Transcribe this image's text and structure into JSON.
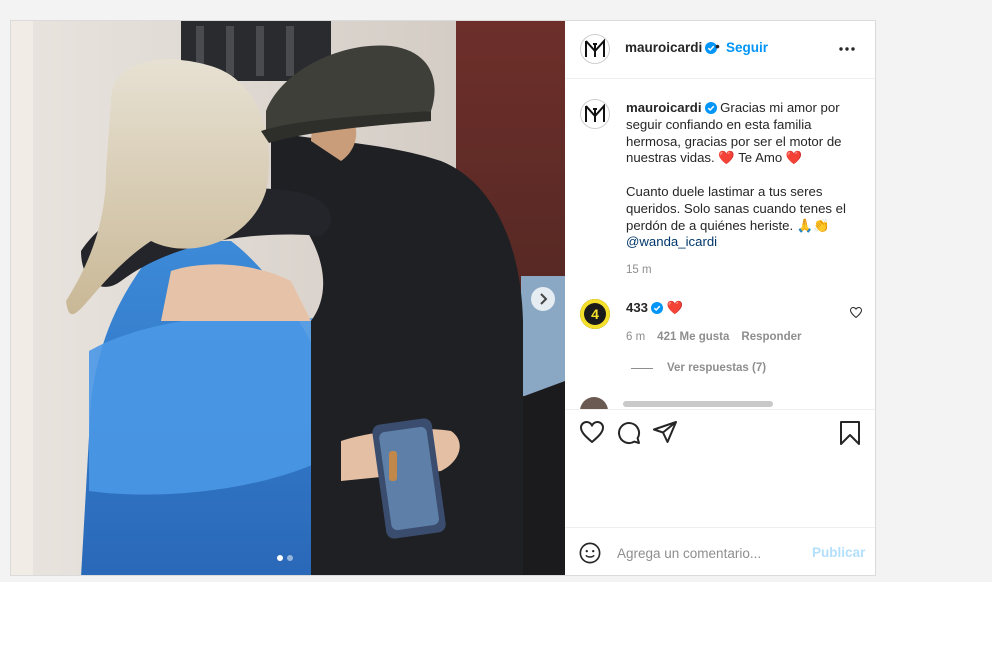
{
  "post": {
    "username": "mauroicardi",
    "separator": "•",
    "follow_label": "Seguir",
    "more_icon": "more-horizontal-icon",
    "caption_lines": [
      "Gracias mi amor por seguir confiando en esta familia hermosa, gracias por ser el motor de nuestras vidas. ❤️ Te Amo ❤️",
      "Cuanto duele lastimar a tus seres queridos. Solo sanas cuando tenes el perdón de a quiénes heriste. 🙏👏"
    ],
    "mention": "@wanda_icardi",
    "caption_time": "15 m"
  },
  "comment": {
    "username": "433",
    "text": "❤️",
    "time": "6 m",
    "likes": "421 Me gusta",
    "reply_label": "Responder",
    "view_replies": "Ver respuestas (7)",
    "avatar_label": "4"
  },
  "composer": {
    "placeholder": "Agrega un comentario...",
    "publish_label": "Publicar"
  },
  "colors": {
    "accent": "#0095f6",
    "text": "#262626",
    "muted": "#8e8e8e",
    "heart": "#e0245e"
  }
}
